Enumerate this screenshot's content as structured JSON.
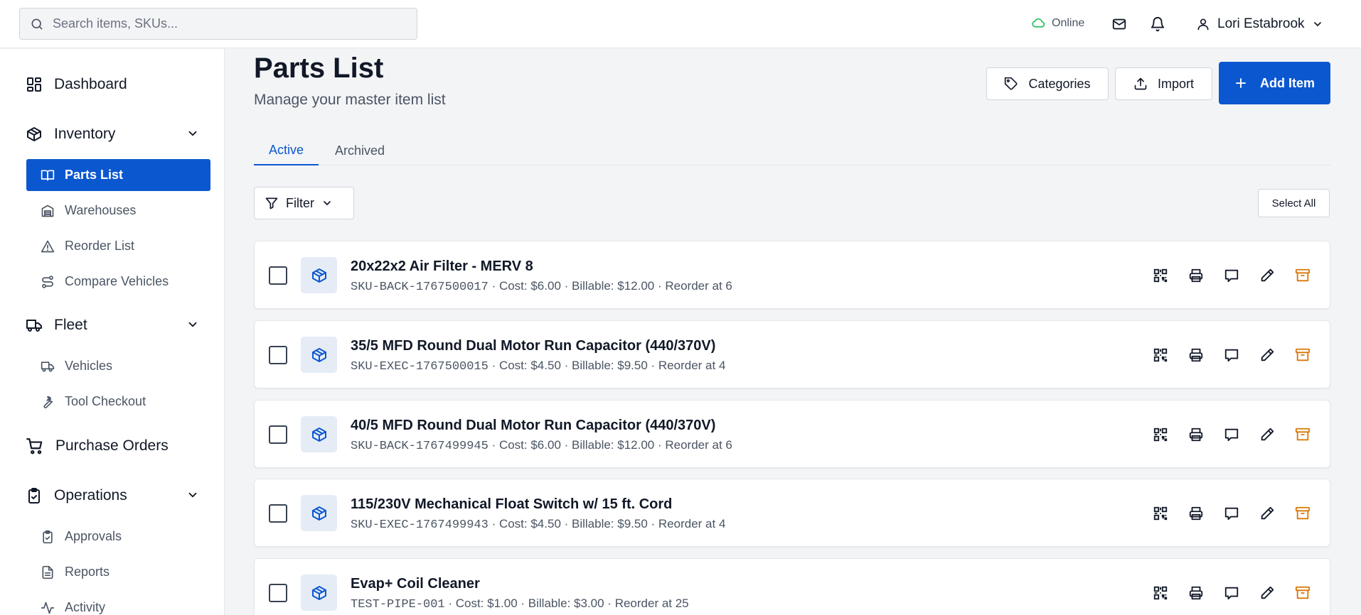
{
  "search": {
    "placeholder": "Search items, SKUs..."
  },
  "status": {
    "label": "Online",
    "color": "#22c55e"
  },
  "user": {
    "name": "Lori Estabrook"
  },
  "sidebar": {
    "dashboard": "Dashboard",
    "inventory": "Inventory",
    "parts_list": "Parts List",
    "warehouses": "Warehouses",
    "reorder_list": "Reorder List",
    "compare_vehicles": "Compare Vehicles",
    "fleet": "Fleet",
    "vehicles": "Vehicles",
    "tool_checkout": "Tool Checkout",
    "purchase_orders": "Purchase Orders",
    "operations": "Operations",
    "approvals": "Approvals",
    "reports": "Reports",
    "activity": "Activity"
  },
  "page": {
    "title": "Parts List",
    "subtitle": "Manage your master item list"
  },
  "actions": {
    "categories": "Categories",
    "import": "Import",
    "add_item": "Add Item"
  },
  "tabs": {
    "active": "Active",
    "archived": "Archived"
  },
  "toolbar": {
    "filter": "Filter",
    "select_all": "Select All"
  },
  "colors": {
    "accent": "#0b57d0",
    "archive": "#d97706"
  },
  "items": [
    {
      "name": "20x22x2 Air Filter - MERV 8",
      "sku": "SKU-BACK-1767500017",
      "details": " · Cost: $6.00 · Billable: $12.00 · Reorder at 6"
    },
    {
      "name": "35/5 MFD Round Dual Motor Run Capacitor (440/370V)",
      "sku": "SKU-EXEC-1767500015",
      "details": " · Cost: $4.50 · Billable: $9.50 · Reorder at 4"
    },
    {
      "name": "40/5 MFD Round Dual Motor Run Capacitor (440/370V)",
      "sku": "SKU-BACK-1767499945",
      "details": " · Cost: $6.00 · Billable: $12.00 · Reorder at 6"
    },
    {
      "name": "115/230V Mechanical Float Switch w/ 15 ft. Cord",
      "sku": "SKU-EXEC-1767499943",
      "details": " · Cost: $4.50 · Billable: $9.50 · Reorder at 4"
    },
    {
      "name": "Evap+ Coil Cleaner",
      "sku": "TEST-PIPE-001",
      "details": " · Cost: $1.00 · Billable: $3.00 · Reorder at 25"
    }
  ]
}
